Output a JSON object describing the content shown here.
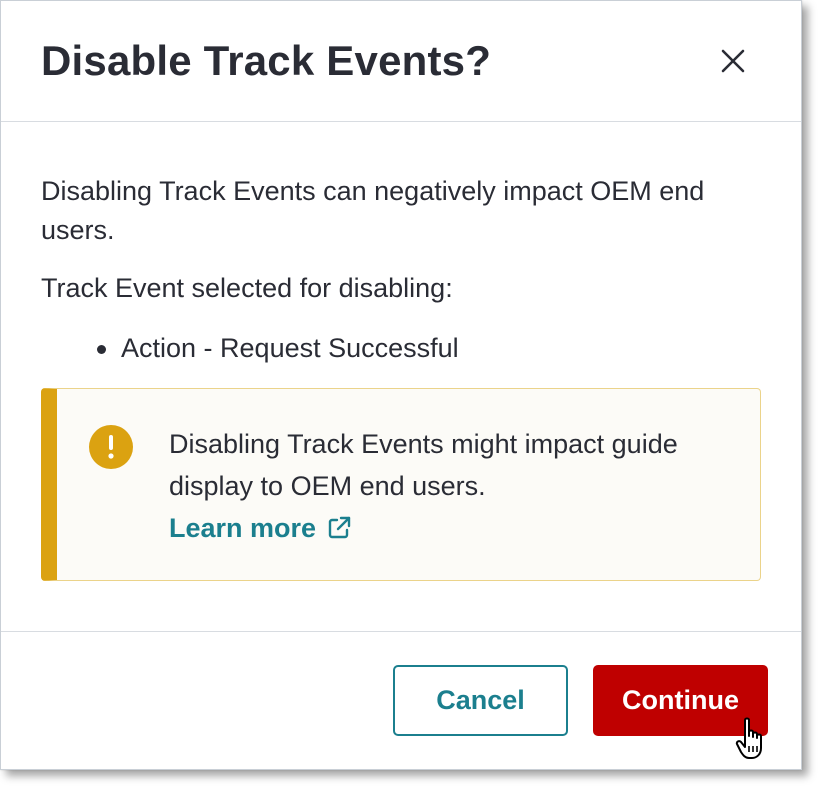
{
  "dialog": {
    "title": "Disable Track Events?",
    "close_icon": "close-icon"
  },
  "body": {
    "warning_text": "Disabling Track Events can negatively impact OEM end users.",
    "selected_label": "Track Event selected for disabling:",
    "selected_items": [
      "Action - Request Successful"
    ]
  },
  "alert": {
    "icon": "exclamation-circle-icon",
    "text": "Disabling Track Events might impact guide display to OEM end users.",
    "link_label": "Learn more",
    "link_icon": "external-link-icon"
  },
  "footer": {
    "cancel_label": "Cancel",
    "continue_label": "Continue"
  },
  "colors": {
    "accent_teal": "#1b7f8e",
    "danger_red": "#bf0000",
    "warning_yellow": "#dba211",
    "text_dark": "#2a2c35"
  }
}
